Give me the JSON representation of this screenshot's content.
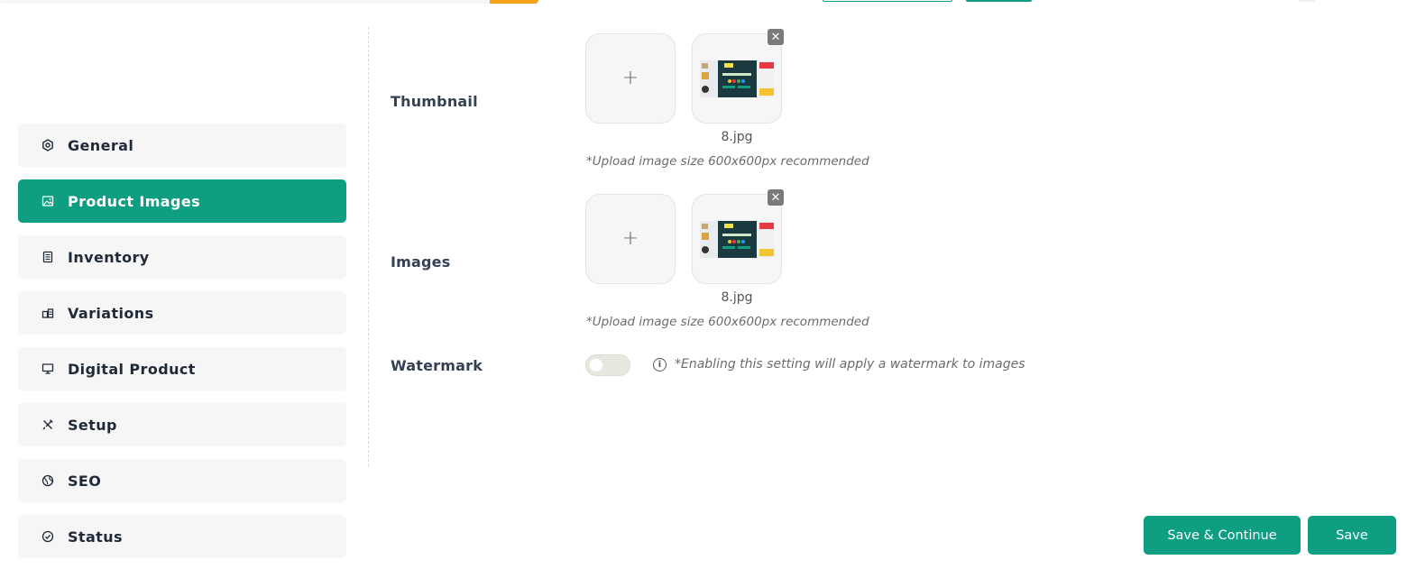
{
  "sidebar": {
    "items": [
      {
        "label": "General",
        "icon": "gear-hex-icon",
        "active": false
      },
      {
        "label": "Product Images",
        "icon": "image-icon",
        "active": true
      },
      {
        "label": "Inventory",
        "icon": "list-doc-icon",
        "active": false
      },
      {
        "label": "Variations",
        "icon": "variations-icon",
        "active": false
      },
      {
        "label": "Digital Product",
        "icon": "monitor-icon",
        "active": false
      },
      {
        "label": "Setup",
        "icon": "tools-icon",
        "active": false
      },
      {
        "label": "SEO",
        "icon": "globe-icon",
        "active": false
      },
      {
        "label": "Status",
        "icon": "check-circle-icon",
        "active": false
      }
    ]
  },
  "form": {
    "thumbnail": {
      "label": "Thumbnail",
      "add_symbol": "+",
      "remove_symbol": "✕",
      "file_name": "8.jpg",
      "hint": "*Upload image size 600x600px recommended"
    },
    "images": {
      "label": "Images",
      "add_symbol": "+",
      "remove_symbol": "✕",
      "file_name": "8.jpg",
      "hint": "*Upload image size 600x600px recommended"
    },
    "watermark": {
      "label": "Watermark",
      "enabled": false,
      "info_symbol": "i",
      "hint": "*Enabling this setting will apply a watermark to images"
    }
  },
  "actions": {
    "save_continue_label": "Save & Continue",
    "save_label": "Save"
  },
  "colors": {
    "accent": "#0e9f83",
    "header_search_button": "#f7a21b",
    "sidebar_bg": "#f6f6f6"
  }
}
